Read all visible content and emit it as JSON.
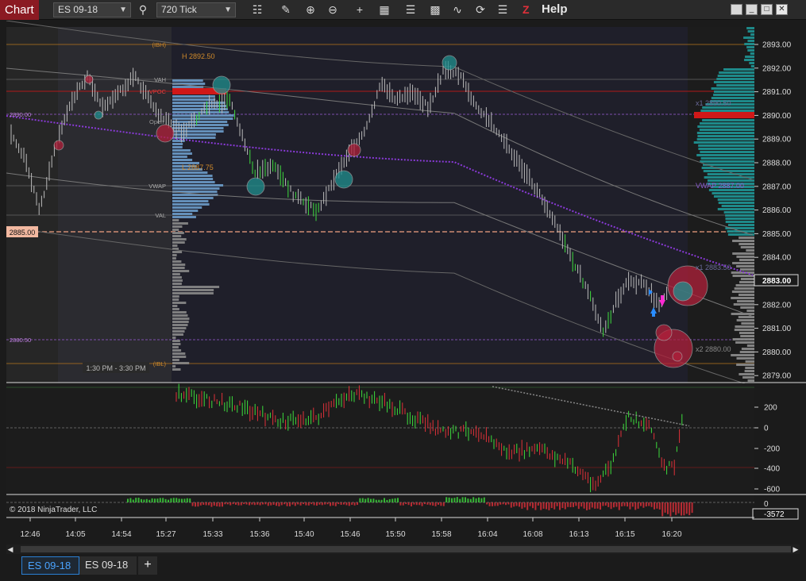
{
  "toolbar": {
    "title": "Chart",
    "instrument": "ES 09-18",
    "interval": "720 Tick",
    "help_label": "Help",
    "z_label": "Z"
  },
  "price_axis": {
    "labels": [
      "2893.00",
      "2892.00",
      "2891.00",
      "2890.00",
      "2889.00",
      "2888.00",
      "2887.00",
      "2886.00",
      "2885.00",
      "2884.00",
      "2883.00",
      "2882.00",
      "2881.00",
      "2880.00",
      "2879.00"
    ],
    "current_price": "2883.00",
    "line_price": "2885.00"
  },
  "profile_labels": {
    "ibh": "(IBH)",
    "high": "H 2892.50",
    "vah": "VAH",
    "vpoc": "VPOC",
    "open": "Open",
    "low": "L 2887.75",
    "vwap": "VWAP",
    "val": "VAL",
    "ibl": "(IBL)",
    "left_price": "2890.00",
    "left_price2": "2880.50",
    "session": "1:30 PM - 3:30 PM"
  },
  "right_labels": {
    "x1_top": "x1 2890.50",
    "vwap": "VWAP 2887.00",
    "x1_mid": "x1 2883.50",
    "x2": "x2 2880.00"
  },
  "indicator_axis": {
    "labels": [
      "200",
      "0",
      "-200",
      "-400",
      "-600"
    ],
    "sub_label": "0",
    "value": "-3572"
  },
  "copyright": "© 2018 NinjaTrader, LLC",
  "time_axis": [
    "12:46",
    "14:05",
    "14:54",
    "15:27",
    "15:33",
    "15:36",
    "15:40",
    "15:46",
    "15:50",
    "15:58",
    "16:04",
    "16:08",
    "16:13",
    "16:15",
    "16:20"
  ],
  "tabs": [
    "ES 09-18",
    "ES 09-18"
  ],
  "colors": {
    "accent": "#8b1a22",
    "up": "#3ddc3d",
    "down": "#e0303a",
    "vpoc": "#cc1111",
    "profile": "#6b9bc9",
    "teal": "#1f8f8f"
  }
}
